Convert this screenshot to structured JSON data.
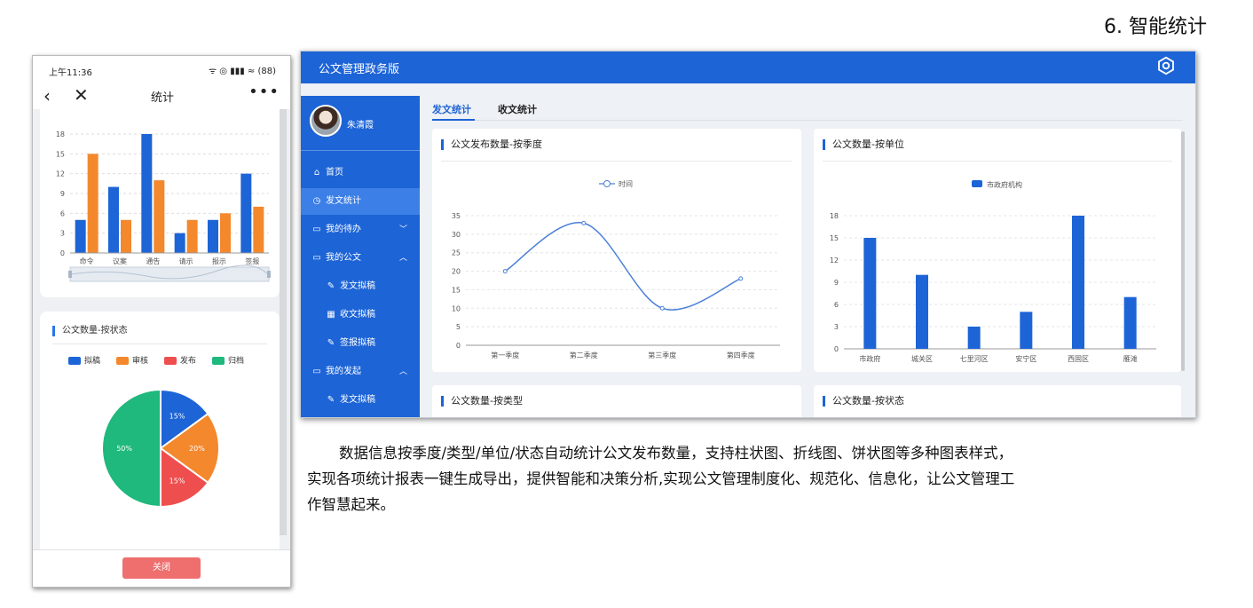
{
  "section_heading": "6. 智能统计",
  "phone": {
    "status_time": "上午11:36",
    "status_icons": "ᯤ ◎  ▮▮▮ ≈ (88)",
    "title": "统计",
    "more": "•••",
    "pie_card_title": "公文数量-按状态",
    "close_button": "关闭",
    "bar_chart": {
      "type": "bar",
      "categories": [
        "命令",
        "议案",
        "通告",
        "请示",
        "报示",
        "签报"
      ],
      "series": [
        {
          "color": "#1d64d6",
          "values": [
            5,
            10,
            18,
            3,
            5,
            12
          ]
        },
        {
          "color": "#f4882d",
          "values": [
            15,
            5,
            11,
            5,
            6,
            7
          ]
        }
      ],
      "yticks": [
        "18",
        "15",
        "12",
        "9",
        "6",
        "3",
        "0"
      ],
      "ylim": [
        0,
        18
      ]
    },
    "pie_legend": [
      {
        "label": "拟稿",
        "color": "#1d64d6"
      },
      {
        "label": "审核",
        "color": "#f4882d"
      },
      {
        "label": "发布",
        "color": "#ef4e4e"
      },
      {
        "label": "归档",
        "color": "#1fb87d"
      }
    ]
  },
  "desktop": {
    "app_title": "公文管理政务版",
    "user_name": "朱清霞",
    "sidebar": [
      {
        "icon": "⌂",
        "label": "首页",
        "chevron": ""
      },
      {
        "icon": "◷",
        "label": "发文统计",
        "chevron": ""
      },
      {
        "icon": "▭",
        "label": "我的待办",
        "chevron": "﹀"
      },
      {
        "icon": "▭",
        "label": "我的公文",
        "chevron": "︿"
      },
      {
        "icon": "✎",
        "label": "发文拟稿",
        "chevron": ""
      },
      {
        "icon": "▦",
        "label": "收文拟稿",
        "chevron": ""
      },
      {
        "icon": "✎",
        "label": "签报拟稿",
        "chevron": ""
      },
      {
        "icon": "▭",
        "label": "我的发起",
        "chevron": "︿"
      },
      {
        "icon": "✎",
        "label": "发文拟稿",
        "chevron": ""
      }
    ],
    "tabs": [
      "发文统计",
      "收文统计"
    ],
    "panels": {
      "line_title": "公文发布数量-按季度",
      "bar_title": "公文数量-按单位",
      "type_title": "公文数量-按类型",
      "status_title": "公文数量-按状态"
    },
    "line_chart": {
      "type": "line",
      "legend": "时间",
      "categories": [
        "第一季度",
        "第二季度",
        "第三季度",
        "第四季度"
      ],
      "values": [
        20,
        33,
        10,
        18
      ],
      "yticks": [
        "35",
        "30",
        "25",
        "20",
        "15",
        "10",
        "5",
        "0"
      ],
      "ylim": [
        0,
        35
      ],
      "color": "#4a7fd8"
    },
    "unit_chart": {
      "type": "bar",
      "legend": "市政府机构",
      "categories": [
        "市政府",
        "城关区",
        "七里河区",
        "安宁区",
        "西固区",
        "雁滩"
      ],
      "values": [
        15,
        10,
        3,
        5,
        18,
        7
      ],
      "yticks": [
        "18",
        "15",
        "12",
        "9",
        "6",
        "3",
        "0"
      ],
      "ylim": [
        0,
        18
      ],
      "color": "#1d64d6"
    }
  },
  "chart_data": [
    {
      "type": "bar",
      "categories": [
        "命令",
        "议案",
        "通告",
        "请示",
        "报示",
        "签报"
      ],
      "series": [
        {
          "values": [
            5,
            10,
            18,
            3,
            5,
            12
          ]
        },
        {
          "values": [
            15,
            5,
            11,
            5,
            6,
            7
          ]
        }
      ],
      "ylim": [
        0,
        18
      ]
    },
    {
      "type": "pie",
      "title": "公文数量-按状态",
      "labels": [
        "拟稿",
        "审核",
        "发布",
        "归档"
      ],
      "values": [
        15,
        20,
        15,
        50
      ],
      "value_labels": [
        "15%",
        "20%",
        "15%",
        "50%"
      ],
      "colors": [
        "#1d64d6",
        "#f4882d",
        "#ef4e4e",
        "#1fb87d"
      ]
    },
    {
      "type": "line",
      "title": "公文发布数量-按季度",
      "series": [
        {
          "name": "时间",
          "values": [
            20,
            33,
            10,
            18
          ]
        }
      ],
      "categories": [
        "第一季度",
        "第二季度",
        "第三季度",
        "第四季度"
      ],
      "ylim": [
        0,
        35
      ]
    },
    {
      "type": "bar",
      "title": "公文数量-按单位",
      "series": [
        {
          "name": "市政府机构",
          "values": [
            15,
            10,
            3,
            5,
            18,
            7
          ]
        }
      ],
      "categories": [
        "市政府",
        "城关区",
        "七里河区",
        "安宁区",
        "西固区",
        "雁滩"
      ],
      "ylim": [
        0,
        18
      ]
    }
  ],
  "description": [
    "数据信息按季度/类型/单位/状态自动统计公文发布数量，支持柱状图、折线图、饼状图等多种图表样式，",
    "实现各项统计报表一键生成导出，提供智能和决策分析,实现公文管理制度化、规范化、信息化，让公文管理工",
    "作智慧起来。"
  ]
}
